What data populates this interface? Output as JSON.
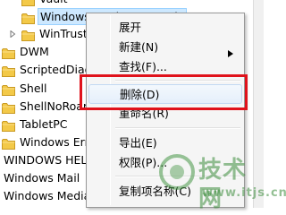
{
  "tree": {
    "rows": [
      {
        "label": "Vault",
        "expandable": false
      },
      {
        "label": "WindowsAnytimeUpgrade",
        "expandable": false,
        "selected": true
      },
      {
        "label": "WinTrust",
        "expandable": true
      },
      {
        "label": "DWM",
        "expandable": false
      },
      {
        "label": "ScriptedDiagnostics",
        "expandable": false
      },
      {
        "label": "Shell",
        "expandable": true
      },
      {
        "label": "ShellNoRoam",
        "expandable": true
      },
      {
        "label": "TabletPC",
        "expandable": true
      },
      {
        "label": "Windows Error Reporting",
        "expandable": true
      },
      {
        "label": "WINDOWS HELP",
        "expandable": false
      },
      {
        "label": "Windows Mail",
        "expandable": false
      },
      {
        "label": "Windows Media",
        "expandable": false
      }
    ]
  },
  "menu": {
    "items": [
      {
        "label": "展开",
        "type": "item"
      },
      {
        "label": "新建(N)",
        "type": "submenu"
      },
      {
        "label": "查找(F)...",
        "type": "item"
      },
      {
        "type": "separator"
      },
      {
        "label": "删除(D)",
        "type": "item",
        "highlighted": true
      },
      {
        "label": "重命名(R)",
        "type": "item"
      },
      {
        "type": "separator"
      },
      {
        "label": "导出(E)",
        "type": "item"
      },
      {
        "label": "权限(P)...",
        "type": "item"
      },
      {
        "type": "separator"
      },
      {
        "label": "复制项名称(C)",
        "type": "item"
      }
    ]
  },
  "watermark": {
    "text": "技术网",
    "url": "www.itjs.cn"
  },
  "colors": {
    "highlight_border": "#e0121b",
    "folder_yellow": "#f3c948",
    "selection_bg": "#cde8ff"
  }
}
